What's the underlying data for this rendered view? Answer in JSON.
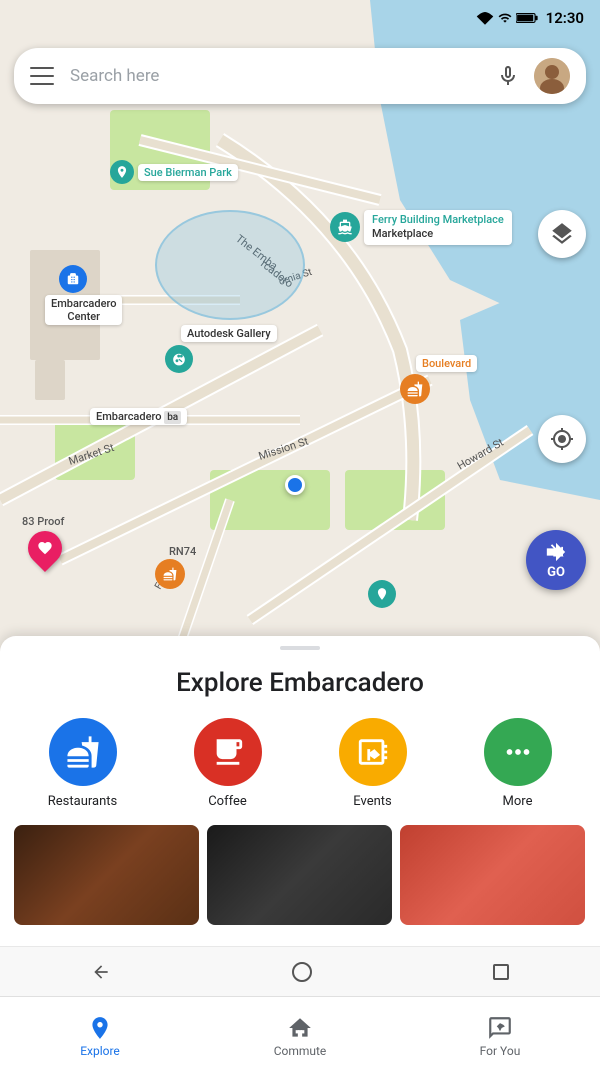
{
  "statusBar": {
    "time": "12:30",
    "wifiIcon": "wifi",
    "signalIcon": "signal",
    "batteryIcon": "battery"
  },
  "searchBar": {
    "placeholder": "Search here",
    "micIcon": "microphone",
    "menuIcon": "hamburger",
    "avatarIcon": "user-avatar"
  },
  "map": {
    "layerButtonIcon": "layers",
    "locationButtonIcon": "my-location",
    "goButtonLabel": "GO",
    "goButtonIcon": "navigation-arrow",
    "places": [
      {
        "name": "Sue Bierman Park",
        "type": "park"
      },
      {
        "name": "Ferry Building Marketplace",
        "type": "landmark"
      },
      {
        "name": "Embarcadero Center",
        "type": "shopping"
      },
      {
        "name": "Autodesk Gallery",
        "type": "art"
      },
      {
        "name": "Boulevard",
        "type": "restaurant"
      },
      {
        "name": "83 Proof",
        "type": "bar"
      },
      {
        "name": "RN74",
        "type": "restaurant"
      },
      {
        "name": "Embarcadero",
        "type": "transit"
      },
      {
        "name": "Market St",
        "type": "street"
      },
      {
        "name": "Mission St",
        "type": "street"
      },
      {
        "name": "Howard St",
        "type": "street"
      }
    ]
  },
  "bottomSheet": {
    "title": "Explore Embarcadero",
    "categories": [
      {
        "label": "Restaurants",
        "color": "#1a73e8",
        "icon": "fork-knife"
      },
      {
        "label": "Coffee",
        "color": "#d93025",
        "icon": "coffee-cup"
      },
      {
        "label": "Events",
        "color": "#f9ab00",
        "icon": "ticket-star"
      },
      {
        "label": "More",
        "color": "#34a853",
        "icon": "dots"
      }
    ]
  },
  "bottomNav": {
    "items": [
      {
        "label": "Explore",
        "icon": "location-pin",
        "active": true
      },
      {
        "label": "Commute",
        "icon": "home-commute",
        "active": false
      },
      {
        "label": "For You",
        "icon": "sparkle-bubble",
        "active": false
      }
    ]
  },
  "androidNav": {
    "backIcon": "triangle-back",
    "homeIcon": "circle-home",
    "recentIcon": "square-recent"
  }
}
